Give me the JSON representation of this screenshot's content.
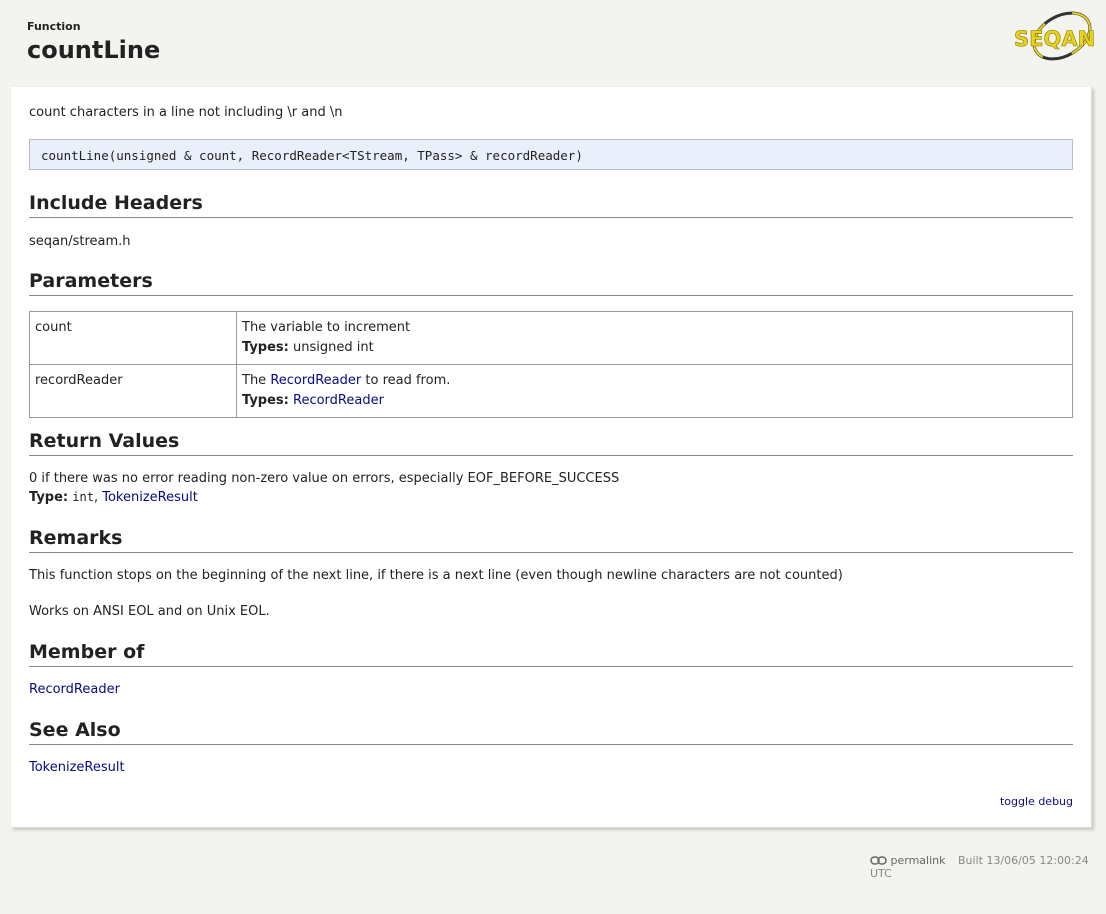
{
  "header": {
    "kind": "Function",
    "title": "countLine"
  },
  "logo": {
    "text": "SEQAN"
  },
  "summary": "count characters in a line not including \\r and \\n",
  "signature": "countLine(unsigned & count, RecordReader<TStream, TPass> & recordReader)",
  "sections": {
    "include_headers": {
      "title": "Include Headers",
      "value": "seqan/stream.h"
    },
    "parameters": {
      "title": "Parameters",
      "types_label": "Types:",
      "rows": [
        {
          "name": "count",
          "desc": "The variable to increment",
          "types": "unsigned int"
        },
        {
          "name": "recordReader",
          "desc_prefix": "The ",
          "desc_link": "RecordReader",
          "desc_suffix": " to read from.",
          "types": "RecordReader"
        }
      ]
    },
    "return_values": {
      "title": "Return Values",
      "text": "0 if there was no error reading non-zero value on errors, especially EOF_BEFORE_SUCCESS",
      "type_label": "Type:",
      "type_mono": "int",
      "type_sep": ", ",
      "type_link": "TokenizeResult"
    },
    "remarks": {
      "title": "Remarks",
      "para1": "This function stops on the beginning of the next line, if there is a next line (even though newline characters are not counted)",
      "para2": "Works on ANSI EOL and on Unix EOL."
    },
    "member_of": {
      "title": "Member of",
      "link": "RecordReader"
    },
    "see_also": {
      "title": "See Also",
      "link": "TokenizeResult"
    }
  },
  "toggle_debug": "toggle debug",
  "footer": {
    "permalink": "permalink",
    "built": "Built 13/06/05 12:00:24 UTC"
  }
}
